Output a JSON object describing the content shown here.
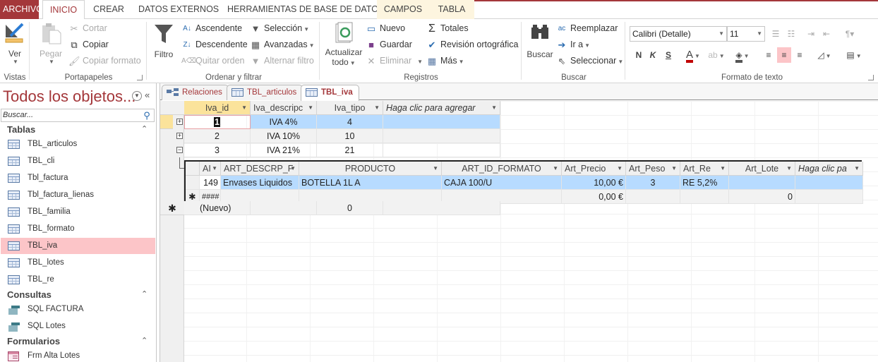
{
  "ribbon_tabs": [
    {
      "label": "ARCHIVO"
    },
    {
      "label": "INICIO"
    },
    {
      "label": "CREAR"
    },
    {
      "label": "DATOS EXTERNOS"
    },
    {
      "label": "HERRAMIENTAS DE BASE DE DATOS"
    },
    {
      "label": "CAMPOS"
    },
    {
      "label": "TABLA"
    }
  ],
  "ribbon": {
    "vistas": {
      "label": "Vistas",
      "ver": "Ver"
    },
    "portapapeles": {
      "label": "Portapapeles",
      "pegar": "Pegar",
      "cortar": "Cortar",
      "copiar": "Copiar",
      "copiar_formato": "Copiar formato"
    },
    "ordenar": {
      "label": "Ordenar y filtrar",
      "filtro": "Filtro",
      "ascendente": "Ascendente",
      "descendente": "Descendente",
      "quitar_orden": "Quitar orden",
      "seleccion": "Selección",
      "avanzadas": "Avanzadas",
      "alternar_filtro": "Alternar filtro"
    },
    "registros": {
      "label": "Registros",
      "actualizar": "Actualizar",
      "todo": "todo",
      "nuevo": "Nuevo",
      "guardar": "Guardar",
      "eliminar": "Eliminar",
      "totales": "Totales",
      "revision": "Revisión ortográfica",
      "mas": "Más"
    },
    "buscar": {
      "label": "Buscar",
      "buscar": "Buscar",
      "reemplazar": "Reemplazar",
      "ir_a": "Ir a",
      "seleccionar": "Seleccionar"
    },
    "formato": {
      "label": "Formato de texto",
      "font": "Calibri (Detalle)",
      "size": "11",
      "bold": "N",
      "italic": "K",
      "underline": "S",
      "font_color": "#c00000"
    }
  },
  "nav": {
    "title": "Todos los objetos...",
    "search_placeholder": "Buscar...",
    "sections": [
      {
        "label": "Tablas",
        "items": [
          "TBL_articulos",
          "TBL_cli",
          "Tbl_factura",
          "Tbl_factura_lienas",
          "TBL_familia",
          "TBL_formato",
          "TBL_iva",
          "TBL_lotes",
          "TBL_re"
        ]
      },
      {
        "label": "Consultas",
        "items": [
          "SQL FACTURA",
          "SQL Lotes"
        ]
      },
      {
        "label": "Formularios",
        "items": [
          "Frm Alta Lotes"
        ]
      }
    ],
    "selected": "TBL_iva"
  },
  "doc_tabs": [
    {
      "label": "Relaciones",
      "icon": "relationships-icon"
    },
    {
      "label": "TBL_articulos",
      "icon": "table-icon"
    },
    {
      "label": "TBL_iva",
      "icon": "table-icon",
      "active": true
    }
  ],
  "main_table": {
    "columns": [
      "Iva_id",
      "Iva_descripc",
      "Iva_tipo",
      "Haga clic para agregar"
    ],
    "rows": [
      {
        "id": "1",
        "desc": "IVA 4%",
        "tipo": "4",
        "expander": "+"
      },
      {
        "id": "2",
        "desc": "IVA 10%",
        "tipo": "10",
        "expander": "+"
      },
      {
        "id": "3",
        "desc": "IVA 21%",
        "tipo": "21",
        "expander": "−"
      }
    ],
    "new_row": {
      "marker": "✱",
      "id": "(Nuevo)",
      "tipo": "0"
    }
  },
  "sub_table": {
    "columns": [
      "AI",
      "ART_DESCRP_F",
      "PRODUCTO",
      "ART_ID_FORMATO",
      "Art_Precio",
      "Art_Peso",
      "Art_Re",
      "Art_Lote",
      "Haga clic pa"
    ],
    "rows": [
      [
        "149",
        "Envases Liquidos",
        "BOTELLA 1L A",
        "CAJA 100/U",
        "10,00 €",
        "3",
        "RE 5,2%",
        "",
        ""
      ]
    ],
    "new_row": {
      "marker": "✱",
      "values": [
        "####",
        "",
        "",
        "",
        "0,00 €",
        "",
        "",
        "0",
        ""
      ]
    }
  }
}
